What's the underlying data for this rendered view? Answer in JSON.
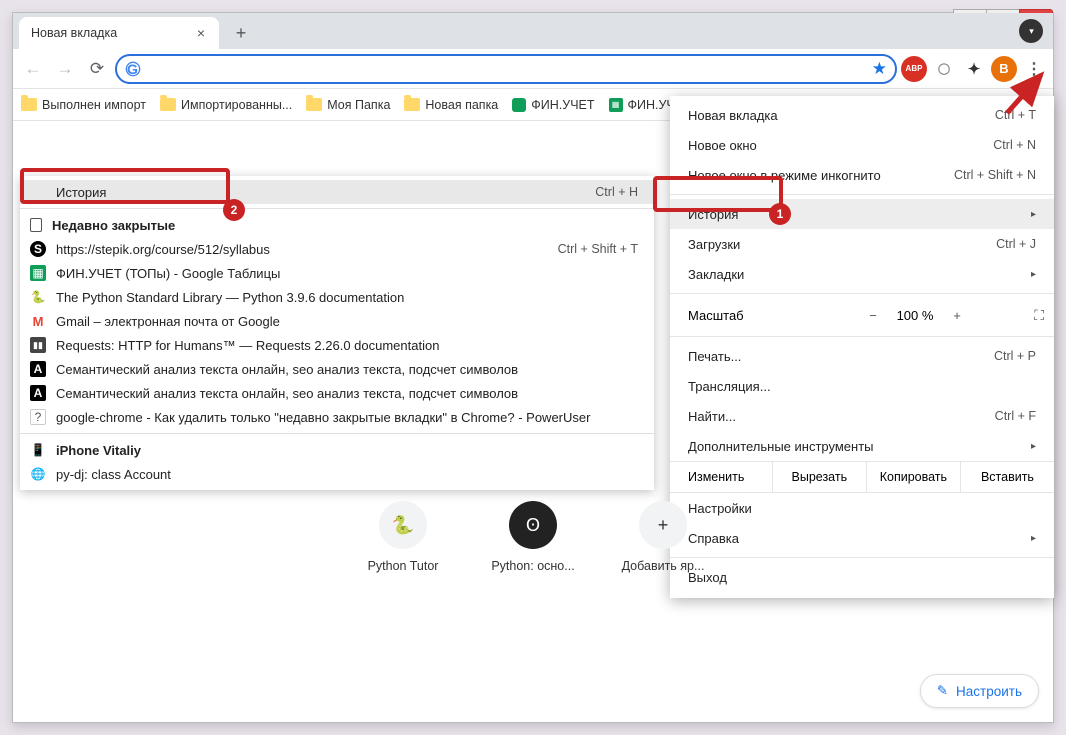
{
  "tab": {
    "title": "Новая вкладка"
  },
  "bookmarks": [
    "Выполнен импорт",
    "Импортированны...",
    "Моя Папка",
    "Новая папка",
    "ФИН.УЧЕТ",
    "ФИН.УЧЕТ..."
  ],
  "profile_letter": "B",
  "submenu": {
    "history": "История",
    "history_shortcut": "Ctrl + H",
    "recent": "Недавно закрытые",
    "reopen_shortcut": "Ctrl + Shift + T",
    "items": [
      "https://stepik.org/course/512/syllabus",
      "ФИН.УЧЕТ (ТОПы) - Google Таблицы",
      "The Python Standard Library — Python 3.9.6 documentation",
      "Gmail – электронная почта от Google",
      "Requests: HTTP for Humans™ — Requests 2.26.0 documentation",
      "Семантический анализ текста онлайн, seo анализ текста, подсчет символов",
      "Семантический анализ текста онлайн, seo анализ текста, подсчет символов",
      "google-chrome - Как удалить только \"недавно закрытые вкладки\" в Chrome? - PowerUser"
    ],
    "device": "iPhone Vitaliy",
    "device_item": "py-dj: class Account"
  },
  "mainmenu": {
    "new_tab": "Новая вкладка",
    "new_tab_sc": "Ctrl + T",
    "new_window": "Новое окно",
    "new_window_sc": "Ctrl + N",
    "incognito": "Новое окно в режиме инкогнито",
    "incognito_sc": "Ctrl + Shift + N",
    "history": "История",
    "downloads": "Загрузки",
    "downloads_sc": "Ctrl + J",
    "bookmarks": "Закладки",
    "zoom_lbl": "Масштаб",
    "zoom_val": "100 %",
    "print": "Печать...",
    "print_sc": "Ctrl + P",
    "cast": "Трансляция...",
    "find": "Найти...",
    "find_sc": "Ctrl + F",
    "more_tools": "Дополнительные инструменты",
    "edit": "Изменить",
    "cut": "Вырезать",
    "copy": "Копировать",
    "paste": "Вставить",
    "settings": "Настройки",
    "help": "Справка",
    "exit": "Выход"
  },
  "tiles": {
    "t1": "Python Tutor",
    "t2": "Python: осно...",
    "t3": "Добавить яр..."
  },
  "customize": "Настроить",
  "badges": {
    "one": "1",
    "two": "2"
  }
}
